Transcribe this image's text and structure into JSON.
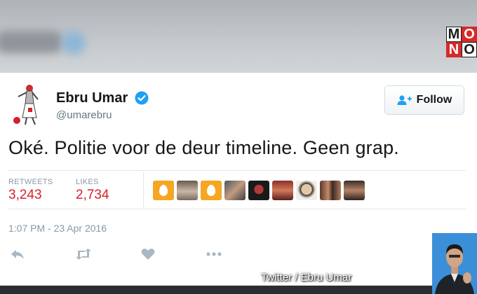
{
  "broadcast": {
    "logo_letters": [
      "M",
      "O",
      "N",
      "O"
    ],
    "credit": "Twitter / Ebru Umar"
  },
  "tweet": {
    "display_name": "Ebru Umar",
    "handle": "@umarebru",
    "follow_label": "Follow",
    "text": "Oké. Politie voor de deur timeline. Geen grap.",
    "retweets_label": "RETWEETS",
    "retweets_count": "3,243",
    "likes_label": "LIKES",
    "likes_count": "2,734",
    "timestamp": "1:07 PM - 23 Apr 2016",
    "liker_avatars": [
      "egg-avatar",
      "photo-avatar",
      "egg-avatar",
      "photo-avatar",
      "photo-avatar",
      "photo-avatar",
      "pug-avatar",
      "photo-avatar",
      "photo-avatar"
    ]
  },
  "icons": [
    "verified-badge-icon",
    "follow-person-plus-icon",
    "reply-icon",
    "retweet-icon",
    "like-heart-icon",
    "more-dots-icon"
  ],
  "colors": {
    "accent": "#1da1f2",
    "count": "#d61f2b",
    "muted": "#8899a6",
    "egg": "#f5a623",
    "logo_red": "#d62a2a"
  }
}
